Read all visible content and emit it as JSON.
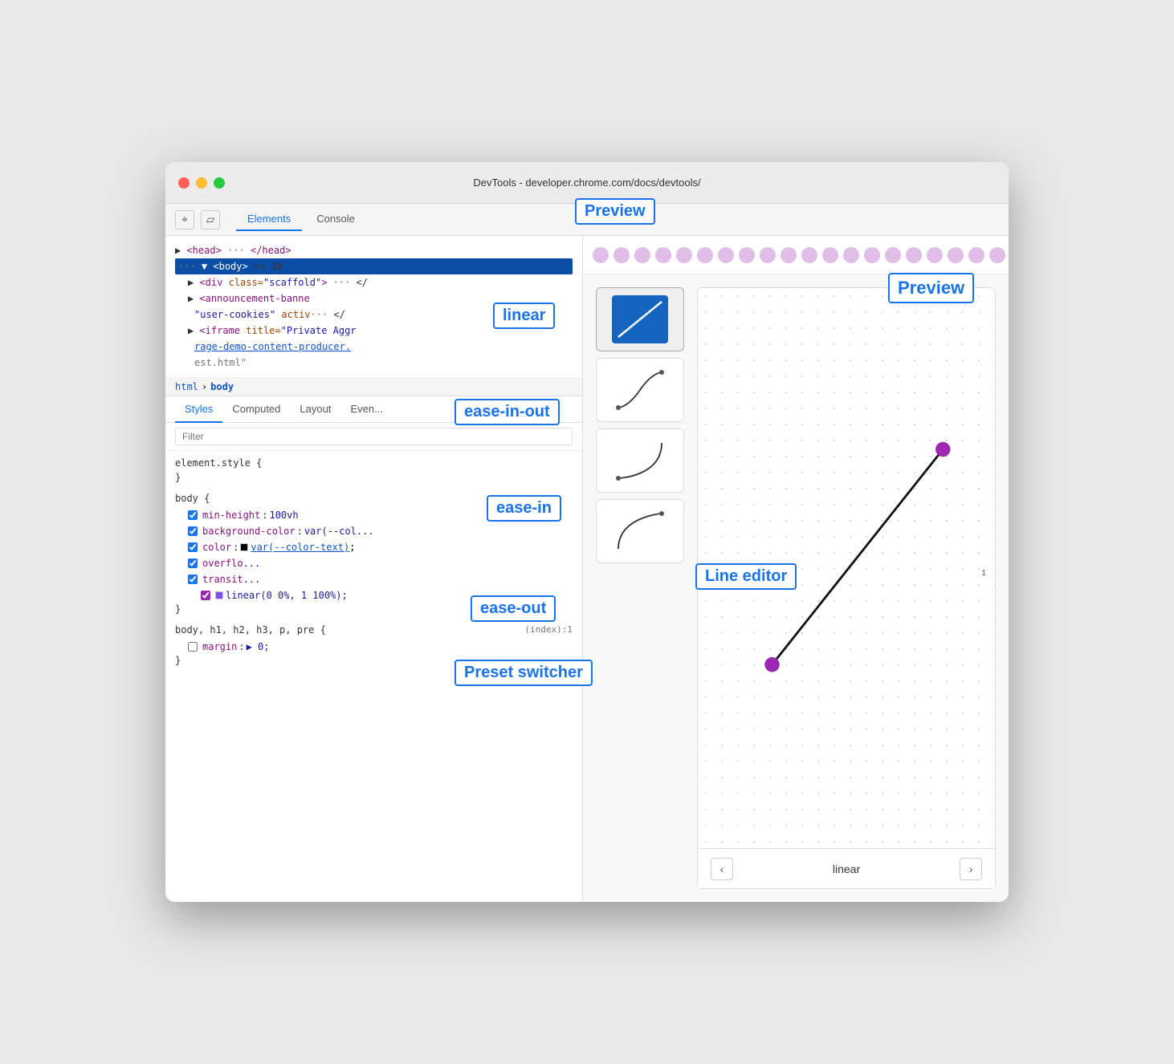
{
  "window": {
    "title": "DevTools - developer.chrome.com/docs/devtools/"
  },
  "tabs": {
    "main": [
      "Elements",
      "Console"
    ],
    "active_main": "Elements",
    "sub": [
      "Styles",
      "Computed",
      "Layout",
      "Even..."
    ],
    "active_sub": "Styles"
  },
  "dom_tree": {
    "lines": [
      {
        "text": "▶ <head> ··· </head>",
        "type": "normal"
      },
      {
        "text": "··· ▼ <body> == $0",
        "type": "selected"
      },
      {
        "text": "  ▶ <div class=\"scaffold\"> ··· </",
        "type": "normal"
      },
      {
        "text": "  ▶ <announcement-banne",
        "type": "normal"
      },
      {
        "text": "    \"user-cookies\" activ ··· </",
        "type": "normal"
      },
      {
        "text": "  ▶ <iframe title=\"Private Aggr",
        "type": "normal"
      },
      {
        "text": "    rage-demo-content-producer.",
        "type": "link"
      },
      {
        "text": "    est.html\"",
        "type": "normal"
      }
    ]
  },
  "breadcrumb": {
    "items": [
      "html",
      "body"
    ]
  },
  "filter": {
    "placeholder": "Filter"
  },
  "styles": {
    "rules": [
      {
        "selector": "element.style {",
        "closing": "}",
        "props": []
      },
      {
        "selector": "body {",
        "closing": "}",
        "source": "",
        "props": [
          {
            "checked": true,
            "name": "min-height",
            "value": "100vh",
            "color": null
          },
          {
            "checked": true,
            "name": "background-color",
            "value": "var(--col...",
            "color": null
          },
          {
            "checked": true,
            "name": "color",
            "value": "var(--color-text);",
            "color": "black",
            "has_swatch": true
          },
          {
            "checked": true,
            "name": "overflo",
            "value": "...",
            "color": null
          },
          {
            "checked": true,
            "name": "transit",
            "value": "...",
            "color": null
          },
          {
            "checked": true,
            "name": "",
            "value": "linear(0 0%, 1 100%);",
            "color": "purple",
            "has_swatch": true,
            "indent": true
          }
        ]
      },
      {
        "selector": "body, h1, h2, h3, p, pre {",
        "closing": "}",
        "source": "(index):1",
        "props": [
          {
            "checked": false,
            "name": "margin",
            "value": "▶ 0;",
            "color": null
          }
        ]
      }
    ]
  },
  "easing_editor": {
    "presets": [
      {
        "id": "linear",
        "label": "linear",
        "active": true
      },
      {
        "id": "ease-in-out",
        "label": "ease-in-out",
        "active": false
      },
      {
        "id": "ease-in",
        "label": "ease-in",
        "active": false
      },
      {
        "id": "ease-out",
        "label": "ease-out",
        "active": false
      }
    ],
    "current_preset": "linear",
    "line_editor_label": "Line editor",
    "preset_switcher_label": "Preset switcher",
    "preview_label": "Preview",
    "nav": {
      "prev": "‹",
      "next": "›"
    }
  },
  "annotations": {
    "preview": "Preview",
    "linear": "linear",
    "ease_in_out": "ease-in-out",
    "ease_in": "ease-in",
    "ease_out": "ease-out",
    "line_editor": "Line editor",
    "preset_switcher": "Preset switcher"
  }
}
